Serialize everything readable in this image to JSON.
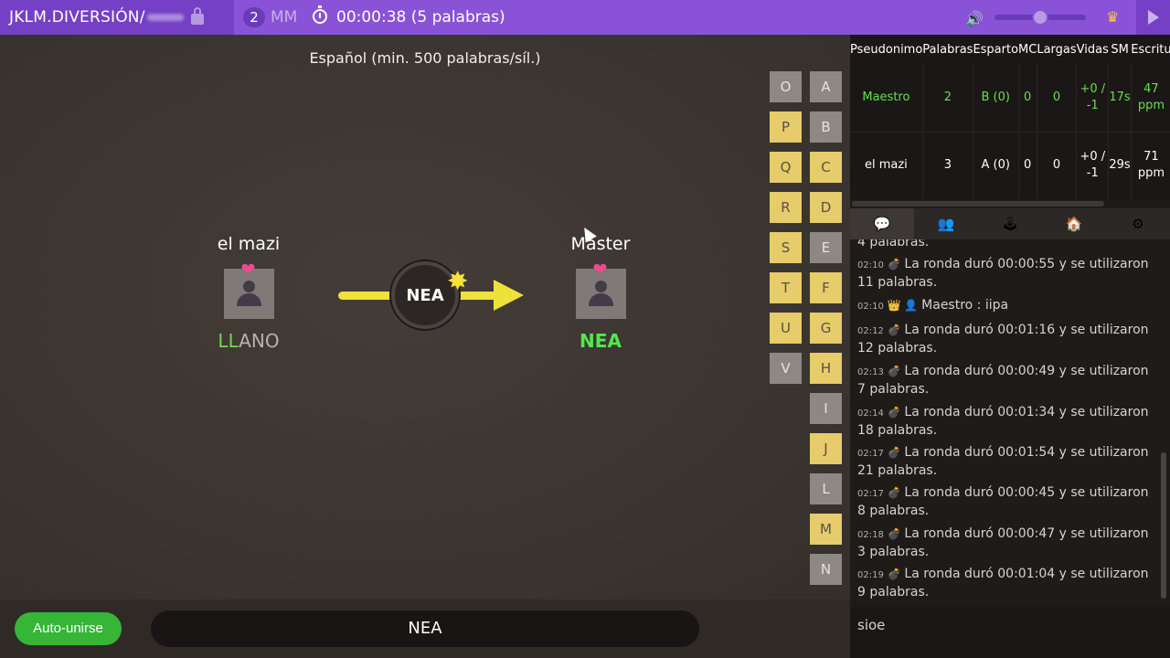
{
  "topbar": {
    "room_code": "JKLM.DIVERSIÓN/",
    "player_count": "2",
    "mode": "MM",
    "timer": "00:00:38 (5 palabras)",
    "icons": [
      "lock-icon",
      "timer-icon",
      "volume-icon",
      "crown-icon",
      "play-icon"
    ]
  },
  "game": {
    "dictionary": "Español (min. 500 palabras/síl.)",
    "syllable": "NEA",
    "players": [
      {
        "name": "el mazi",
        "word_ok": "LL",
        "word_rest": "ANO"
      },
      {
        "name": "Master",
        "word": "NEA"
      }
    ],
    "letters_left": [
      {
        "letter": "O",
        "used": false
      },
      {
        "letter": "P",
        "used": true
      },
      {
        "letter": "Q",
        "used": true
      },
      {
        "letter": "R",
        "used": true
      },
      {
        "letter": "S",
        "used": true
      },
      {
        "letter": "T",
        "used": true
      },
      {
        "letter": "U",
        "used": true
      },
      {
        "letter": "V",
        "used": false
      }
    ],
    "letters_right": [
      {
        "letter": "A",
        "used": false
      },
      {
        "letter": "B",
        "used": false
      },
      {
        "letter": "C",
        "used": true
      },
      {
        "letter": "D",
        "used": true
      },
      {
        "letter": "E",
        "used": false
      },
      {
        "letter": "F",
        "used": true
      },
      {
        "letter": "G",
        "used": true
      },
      {
        "letter": "H",
        "used": true
      },
      {
        "letter": "I",
        "used": false
      },
      {
        "letter": "J",
        "used": true
      },
      {
        "letter": "L",
        "used": false
      },
      {
        "letter": "M",
        "used": true
      },
      {
        "letter": "N",
        "used": false
      }
    ]
  },
  "bottom": {
    "autojoin_label": "Auto-unirse",
    "input_value": "NEA"
  },
  "scoreboard": {
    "headers": [
      "Pseudonimo",
      "Palabras",
      "Esparto",
      "MC",
      "Largas",
      "Vidas",
      "SM",
      "Escritu"
    ],
    "rows": [
      [
        "Maestro",
        "2",
        "B (0)",
        "0",
        "0",
        "+0 / -1",
        "17s",
        "47 ppm"
      ],
      [
        "el mazi",
        "3",
        "A (0)",
        "0",
        "0",
        "+0 / -1",
        "29s",
        "71 ppm"
      ]
    ]
  },
  "chat": {
    "partial_top": "4 palabras.",
    "messages": [
      {
        "time": "02:10",
        "text": "La ronda duró 00:00:55 y se utilizaron 11 palabras."
      },
      {
        "time": "02:10",
        "text": "Maestro : iipa",
        "kind": "user"
      },
      {
        "time": "02:12",
        "text": "La ronda duró 00:01:16 y se utilizaron 12 palabras."
      },
      {
        "time": "02:13",
        "text": "La ronda duró 00:00:49 y se utilizaron 7 palabras."
      },
      {
        "time": "02:14",
        "text": "La ronda duró 00:01:34 y se utilizaron 18 palabras."
      },
      {
        "time": "02:17",
        "text": "La ronda duró 00:01:54 y se utilizaron 21 palabras."
      },
      {
        "time": "02:17",
        "text": "La ronda duró 00:00:45 y se utilizaron 8 palabras."
      },
      {
        "time": "02:18",
        "text": "La ronda duró 00:00:47 y se utilizaron 3 palabras."
      },
      {
        "time": "02:19",
        "text": "La ronda duró 00:01:04 y se utilizaron 9 palabras."
      }
    ],
    "input_value": "sioe"
  },
  "tabs": [
    "chat-tab",
    "players-tab",
    "game-tab",
    "room-tab",
    "settings-tab"
  ]
}
